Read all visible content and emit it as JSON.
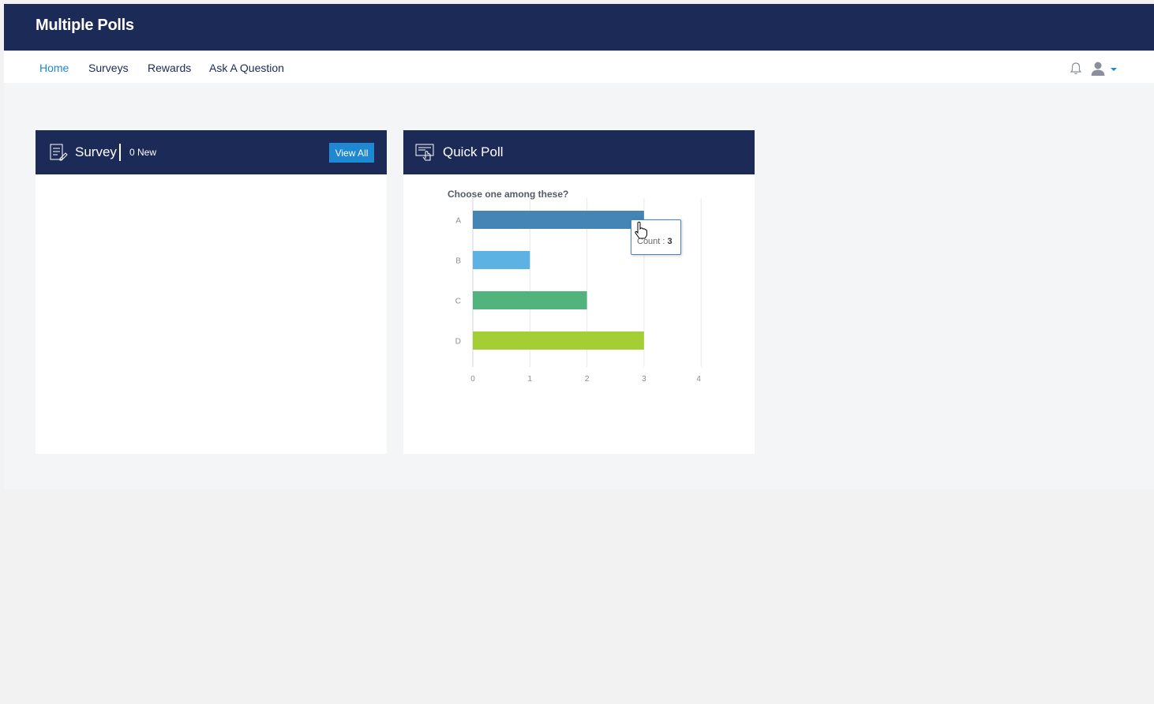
{
  "app": {
    "title": "Multiple Polls"
  },
  "nav": {
    "items": [
      {
        "label": "Home",
        "active": true
      },
      {
        "label": "Surveys",
        "active": false
      },
      {
        "label": "Rewards",
        "active": false
      },
      {
        "label": "Ask A Question",
        "active": false
      }
    ],
    "icons": [
      "bell-icon",
      "user-icon",
      "caret-down-icon"
    ]
  },
  "survey_panel": {
    "title": "Survey",
    "new_count": "0 New",
    "view_all_label": "View All"
  },
  "quick_poll_panel": {
    "title": "Quick Poll",
    "question": "Choose one among these?",
    "tooltip": {
      "label": "Count : ",
      "value": "3"
    }
  },
  "colors": {
    "header_bg": "#1c2a57",
    "accent": "#1e88d2",
    "bar_A": "#4485b5",
    "bar_B": "#5cb3e3",
    "bar_C": "#52b47d",
    "bar_D": "#a3cf35"
  },
  "chart_data": {
    "type": "bar",
    "orientation": "horizontal",
    "categories": [
      "A",
      "B",
      "C",
      "D"
    ],
    "values": [
      3,
      1,
      2,
      3
    ],
    "xlim": [
      0,
      4
    ],
    "x_ticks": [
      "0",
      "1",
      "2",
      "3",
      "4"
    ],
    "title": "Choose one among these?",
    "grid": true
  }
}
